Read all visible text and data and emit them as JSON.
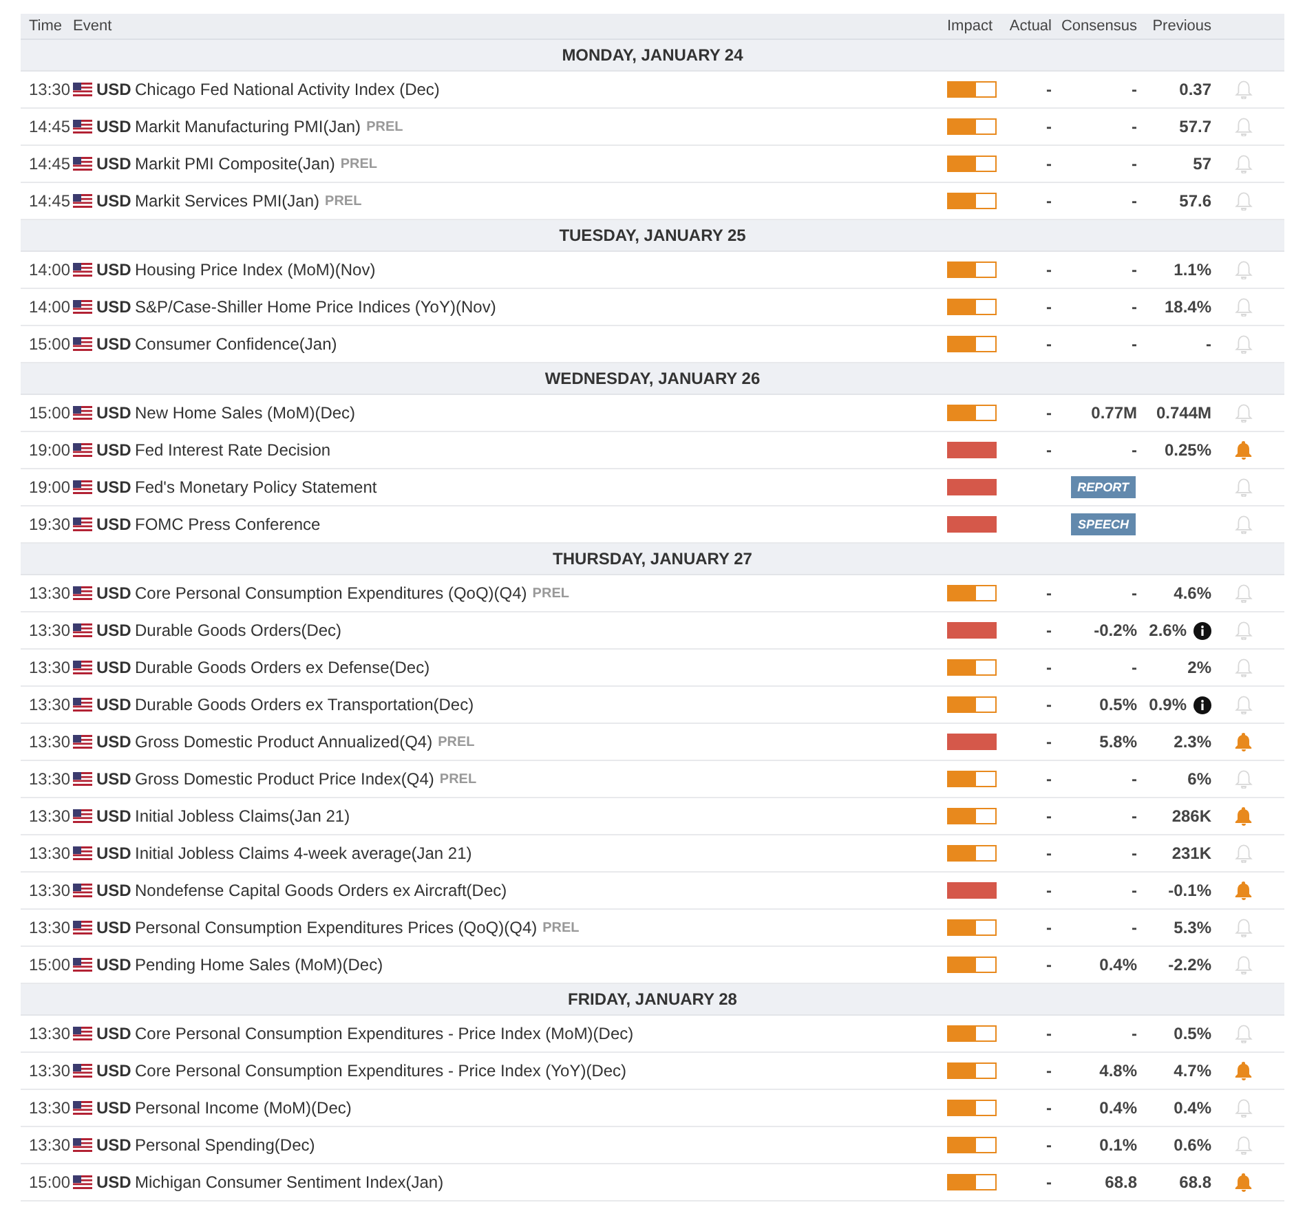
{
  "columns": [
    "Time",
    "Event",
    "Impact",
    "Actual",
    "Consensus",
    "Previous"
  ],
  "days": [
    {
      "label": "MONDAY, JANUARY 24",
      "events": [
        {
          "time": "13:30",
          "currency": "USD",
          "name": "Chicago Fed National Activity Index (Dec)",
          "impact": {
            "level": 0.6
          },
          "actual": "-",
          "consensus": "-",
          "previous": "0.37",
          "alert": false
        },
        {
          "time": "14:45",
          "currency": "USD",
          "name": "Markit Manufacturing PMI(Jan)",
          "tag": "PREL",
          "impact": {
            "level": 0.6
          },
          "actual": "-",
          "consensus": "-",
          "previous": "57.7",
          "alert": false
        },
        {
          "time": "14:45",
          "currency": "USD",
          "name": "Markit PMI Composite(Jan)",
          "tag": "PREL",
          "impact": {
            "level": 0.6
          },
          "actual": "-",
          "consensus": "-",
          "previous": "57",
          "alert": false
        },
        {
          "time": "14:45",
          "currency": "USD",
          "name": "Markit Services PMI(Jan)",
          "tag": "PREL",
          "impact": {
            "level": 0.6
          },
          "actual": "-",
          "consensus": "-",
          "previous": "57.6",
          "alert": false
        }
      ]
    },
    {
      "label": "TUESDAY, JANUARY 25",
      "events": [
        {
          "time": "14:00",
          "currency": "USD",
          "name": "Housing Price Index (MoM)(Nov)",
          "impact": {
            "level": 0.6
          },
          "actual": "-",
          "consensus": "-",
          "previous": "1.1%",
          "alert": false
        },
        {
          "time": "14:00",
          "currency": "USD",
          "name": "S&P/Case-Shiller Home Price Indices (YoY)(Nov)",
          "impact": {
            "level": 0.6
          },
          "actual": "-",
          "consensus": "-",
          "previous": "18.4%",
          "alert": false
        },
        {
          "time": "15:00",
          "currency": "USD",
          "name": "Consumer Confidence(Jan)",
          "impact": {
            "level": 0.6
          },
          "actual": "-",
          "consensus": "-",
          "previous": "-",
          "alert": false
        }
      ]
    },
    {
      "label": "WEDNESDAY, JANUARY 26",
      "events": [
        {
          "time": "15:00",
          "currency": "USD",
          "name": "New Home Sales (MoM)(Dec)",
          "impact": {
            "level": 0.6
          },
          "actual": "-",
          "consensus": "0.77M",
          "previous": "0.744M",
          "alert": false
        },
        {
          "time": "19:00",
          "currency": "USD",
          "name": "Fed Interest Rate Decision",
          "impact": {
            "level": 1
          },
          "actual": "-",
          "consensus": "-",
          "previous": "0.25%",
          "alert": true
        },
        {
          "time": "19:00",
          "currency": "USD",
          "name": "Fed's Monetary Policy Statement",
          "impact": {
            "level": 1
          },
          "badge": "REPORT",
          "alert": false
        },
        {
          "time": "19:30",
          "currency": "USD",
          "name": "FOMC Press Conference",
          "impact": {
            "level": 1
          },
          "badge": "SPEECH",
          "alert": false
        }
      ]
    },
    {
      "label": "THURSDAY, JANUARY 27",
      "events": [
        {
          "time": "13:30",
          "currency": "USD",
          "name": "Core Personal Consumption Expenditures (QoQ)(Q4)",
          "tag": "PREL",
          "impact": {
            "level": 0.6
          },
          "actual": "-",
          "consensus": "-",
          "previous": "4.6%",
          "alert": false
        },
        {
          "time": "13:30",
          "currency": "USD",
          "name": "Durable Goods Orders(Dec)",
          "impact": {
            "level": 1
          },
          "actual": "-",
          "consensus": "-0.2%",
          "previous": "2.6%",
          "info": true,
          "alert": false
        },
        {
          "time": "13:30",
          "currency": "USD",
          "name": "Durable Goods Orders ex Defense(Dec)",
          "impact": {
            "level": 0.6
          },
          "actual": "-",
          "consensus": "-",
          "previous": "2%",
          "alert": false
        },
        {
          "time": "13:30",
          "currency": "USD",
          "name": "Durable Goods Orders ex Transportation(Dec)",
          "impact": {
            "level": 0.6
          },
          "actual": "-",
          "consensus": "0.5%",
          "previous": "0.9%",
          "info": true,
          "alert": false
        },
        {
          "time": "13:30",
          "currency": "USD",
          "name": "Gross Domestic Product Annualized(Q4)",
          "tag": "PREL",
          "impact": {
            "level": 1
          },
          "actual": "-",
          "consensus": "5.8%",
          "previous": "2.3%",
          "alert": true
        },
        {
          "time": "13:30",
          "currency": "USD",
          "name": "Gross Domestic Product Price Index(Q4)",
          "tag": "PREL",
          "impact": {
            "level": 0.6
          },
          "actual": "-",
          "consensus": "-",
          "previous": "6%",
          "alert": false
        },
        {
          "time": "13:30",
          "currency": "USD",
          "name": "Initial Jobless Claims(Jan 21)",
          "impact": {
            "level": 0.6
          },
          "actual": "-",
          "consensus": "-",
          "previous": "286K",
          "alert": true
        },
        {
          "time": "13:30",
          "currency": "USD",
          "name": "Initial Jobless Claims 4-week average(Jan 21)",
          "impact": {
            "level": 0.6
          },
          "actual": "-",
          "consensus": "-",
          "previous": "231K",
          "alert": false
        },
        {
          "time": "13:30",
          "currency": "USD",
          "name": "Nondefense Capital Goods Orders ex Aircraft(Dec)",
          "impact": {
            "level": 1
          },
          "actual": "-",
          "consensus": "-",
          "previous": "-0.1%",
          "alert": true
        },
        {
          "time": "13:30",
          "currency": "USD",
          "name": "Personal Consumption Expenditures Prices (QoQ)(Q4)",
          "tag": "PREL",
          "impact": {
            "level": 0.6
          },
          "actual": "-",
          "consensus": "-",
          "previous": "5.3%",
          "alert": false
        },
        {
          "time": "15:00",
          "currency": "USD",
          "name": "Pending Home Sales (MoM)(Dec)",
          "impact": {
            "level": 0.6
          },
          "actual": "-",
          "consensus": "0.4%",
          "previous": "-2.2%",
          "alert": false
        }
      ]
    },
    {
      "label": "FRIDAY, JANUARY 28",
      "events": [
        {
          "time": "13:30",
          "currency": "USD",
          "name": "Core Personal Consumption Expenditures - Price Index (MoM)(Dec)",
          "impact": {
            "level": 0.6
          },
          "actual": "-",
          "consensus": "-",
          "previous": "0.5%",
          "alert": false
        },
        {
          "time": "13:30",
          "currency": "USD",
          "name": "Core Personal Consumption Expenditures - Price Index (YoY)(Dec)",
          "impact": {
            "level": 0.6
          },
          "actual": "-",
          "consensus": "4.8%",
          "previous": "4.7%",
          "alert": true
        },
        {
          "time": "13:30",
          "currency": "USD",
          "name": "Personal Income (MoM)(Dec)",
          "impact": {
            "level": 0.6
          },
          "actual": "-",
          "consensus": "0.4%",
          "previous": "0.4%",
          "alert": false
        },
        {
          "time": "13:30",
          "currency": "USD",
          "name": "Personal Spending(Dec)",
          "impact": {
            "level": 0.6
          },
          "actual": "-",
          "consensus": "0.1%",
          "previous": "0.6%",
          "alert": false
        },
        {
          "time": "15:00",
          "currency": "USD",
          "name": "Michigan Consumer Sentiment Index(Jan)",
          "impact": {
            "level": 0.6
          },
          "actual": "-",
          "consensus": "68.8",
          "previous": "68.8",
          "alert": true
        }
      ]
    }
  ]
}
